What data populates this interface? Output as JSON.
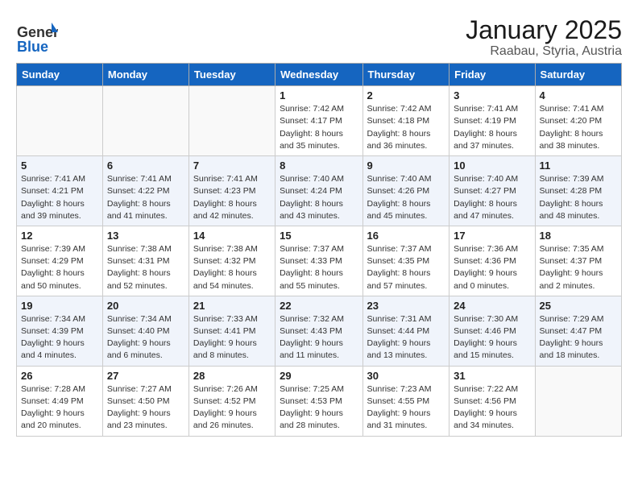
{
  "header": {
    "logo_general": "General",
    "logo_blue": "Blue",
    "title": "January 2025",
    "subtitle": "Raabau, Styria, Austria"
  },
  "weekdays": [
    "Sunday",
    "Monday",
    "Tuesday",
    "Wednesday",
    "Thursday",
    "Friday",
    "Saturday"
  ],
  "weeks": [
    [
      {
        "day": "",
        "sunrise": "",
        "sunset": "",
        "daylight": ""
      },
      {
        "day": "",
        "sunrise": "",
        "sunset": "",
        "daylight": ""
      },
      {
        "day": "",
        "sunrise": "",
        "sunset": "",
        "daylight": ""
      },
      {
        "day": "1",
        "sunrise": "Sunrise: 7:42 AM",
        "sunset": "Sunset: 4:17 PM",
        "daylight": "Daylight: 8 hours and 35 minutes."
      },
      {
        "day": "2",
        "sunrise": "Sunrise: 7:42 AM",
        "sunset": "Sunset: 4:18 PM",
        "daylight": "Daylight: 8 hours and 36 minutes."
      },
      {
        "day": "3",
        "sunrise": "Sunrise: 7:41 AM",
        "sunset": "Sunset: 4:19 PM",
        "daylight": "Daylight: 8 hours and 37 minutes."
      },
      {
        "day": "4",
        "sunrise": "Sunrise: 7:41 AM",
        "sunset": "Sunset: 4:20 PM",
        "daylight": "Daylight: 8 hours and 38 minutes."
      }
    ],
    [
      {
        "day": "5",
        "sunrise": "Sunrise: 7:41 AM",
        "sunset": "Sunset: 4:21 PM",
        "daylight": "Daylight: 8 hours and 39 minutes."
      },
      {
        "day": "6",
        "sunrise": "Sunrise: 7:41 AM",
        "sunset": "Sunset: 4:22 PM",
        "daylight": "Daylight: 8 hours and 41 minutes."
      },
      {
        "day": "7",
        "sunrise": "Sunrise: 7:41 AM",
        "sunset": "Sunset: 4:23 PM",
        "daylight": "Daylight: 8 hours and 42 minutes."
      },
      {
        "day": "8",
        "sunrise": "Sunrise: 7:40 AM",
        "sunset": "Sunset: 4:24 PM",
        "daylight": "Daylight: 8 hours and 43 minutes."
      },
      {
        "day": "9",
        "sunrise": "Sunrise: 7:40 AM",
        "sunset": "Sunset: 4:26 PM",
        "daylight": "Daylight: 8 hours and 45 minutes."
      },
      {
        "day": "10",
        "sunrise": "Sunrise: 7:40 AM",
        "sunset": "Sunset: 4:27 PM",
        "daylight": "Daylight: 8 hours and 47 minutes."
      },
      {
        "day": "11",
        "sunrise": "Sunrise: 7:39 AM",
        "sunset": "Sunset: 4:28 PM",
        "daylight": "Daylight: 8 hours and 48 minutes."
      }
    ],
    [
      {
        "day": "12",
        "sunrise": "Sunrise: 7:39 AM",
        "sunset": "Sunset: 4:29 PM",
        "daylight": "Daylight: 8 hours and 50 minutes."
      },
      {
        "day": "13",
        "sunrise": "Sunrise: 7:38 AM",
        "sunset": "Sunset: 4:31 PM",
        "daylight": "Daylight: 8 hours and 52 minutes."
      },
      {
        "day": "14",
        "sunrise": "Sunrise: 7:38 AM",
        "sunset": "Sunset: 4:32 PM",
        "daylight": "Daylight: 8 hours and 54 minutes."
      },
      {
        "day": "15",
        "sunrise": "Sunrise: 7:37 AM",
        "sunset": "Sunset: 4:33 PM",
        "daylight": "Daylight: 8 hours and 55 minutes."
      },
      {
        "day": "16",
        "sunrise": "Sunrise: 7:37 AM",
        "sunset": "Sunset: 4:35 PM",
        "daylight": "Daylight: 8 hours and 57 minutes."
      },
      {
        "day": "17",
        "sunrise": "Sunrise: 7:36 AM",
        "sunset": "Sunset: 4:36 PM",
        "daylight": "Daylight: 9 hours and 0 minutes."
      },
      {
        "day": "18",
        "sunrise": "Sunrise: 7:35 AM",
        "sunset": "Sunset: 4:37 PM",
        "daylight": "Daylight: 9 hours and 2 minutes."
      }
    ],
    [
      {
        "day": "19",
        "sunrise": "Sunrise: 7:34 AM",
        "sunset": "Sunset: 4:39 PM",
        "daylight": "Daylight: 9 hours and 4 minutes."
      },
      {
        "day": "20",
        "sunrise": "Sunrise: 7:34 AM",
        "sunset": "Sunset: 4:40 PM",
        "daylight": "Daylight: 9 hours and 6 minutes."
      },
      {
        "day": "21",
        "sunrise": "Sunrise: 7:33 AM",
        "sunset": "Sunset: 4:41 PM",
        "daylight": "Daylight: 9 hours and 8 minutes."
      },
      {
        "day": "22",
        "sunrise": "Sunrise: 7:32 AM",
        "sunset": "Sunset: 4:43 PM",
        "daylight": "Daylight: 9 hours and 11 minutes."
      },
      {
        "day": "23",
        "sunrise": "Sunrise: 7:31 AM",
        "sunset": "Sunset: 4:44 PM",
        "daylight": "Daylight: 9 hours and 13 minutes."
      },
      {
        "day": "24",
        "sunrise": "Sunrise: 7:30 AM",
        "sunset": "Sunset: 4:46 PM",
        "daylight": "Daylight: 9 hours and 15 minutes."
      },
      {
        "day": "25",
        "sunrise": "Sunrise: 7:29 AM",
        "sunset": "Sunset: 4:47 PM",
        "daylight": "Daylight: 9 hours and 18 minutes."
      }
    ],
    [
      {
        "day": "26",
        "sunrise": "Sunrise: 7:28 AM",
        "sunset": "Sunset: 4:49 PM",
        "daylight": "Daylight: 9 hours and 20 minutes."
      },
      {
        "day": "27",
        "sunrise": "Sunrise: 7:27 AM",
        "sunset": "Sunset: 4:50 PM",
        "daylight": "Daylight: 9 hours and 23 minutes."
      },
      {
        "day": "28",
        "sunrise": "Sunrise: 7:26 AM",
        "sunset": "Sunset: 4:52 PM",
        "daylight": "Daylight: 9 hours and 26 minutes."
      },
      {
        "day": "29",
        "sunrise": "Sunrise: 7:25 AM",
        "sunset": "Sunset: 4:53 PM",
        "daylight": "Daylight: 9 hours and 28 minutes."
      },
      {
        "day": "30",
        "sunrise": "Sunrise: 7:23 AM",
        "sunset": "Sunset: 4:55 PM",
        "daylight": "Daylight: 9 hours and 31 minutes."
      },
      {
        "day": "31",
        "sunrise": "Sunrise: 7:22 AM",
        "sunset": "Sunset: 4:56 PM",
        "daylight": "Daylight: 9 hours and 34 minutes."
      },
      {
        "day": "",
        "sunrise": "",
        "sunset": "",
        "daylight": ""
      }
    ]
  ]
}
